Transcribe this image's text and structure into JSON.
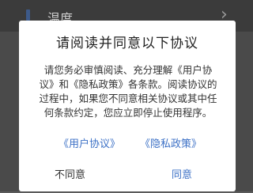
{
  "background": {
    "row_label": "温度",
    "chevron": "›"
  },
  "dialog": {
    "title": "请阅读并同意以下协议",
    "body": "请您务必审慎阅读、充分理解《用户协议》和《隐私政策》各条款。阅读协议的过程中，如果您不同意相关协议或其中任何条款约定，您应立即停止使用程序。",
    "links": {
      "user_agreement": "《用户协议》",
      "privacy_policy": "《隐私政策》"
    },
    "buttons": {
      "disagree": "不同意",
      "agree": "同意"
    }
  },
  "colors": {
    "accent": "#3d71c6",
    "overlay": "#4a4a4a",
    "dialog_bg": "#ffffff"
  },
  "icons": {
    "row_icon": "thermometer-icon",
    "row_chevron": "chevron-right-icon"
  }
}
